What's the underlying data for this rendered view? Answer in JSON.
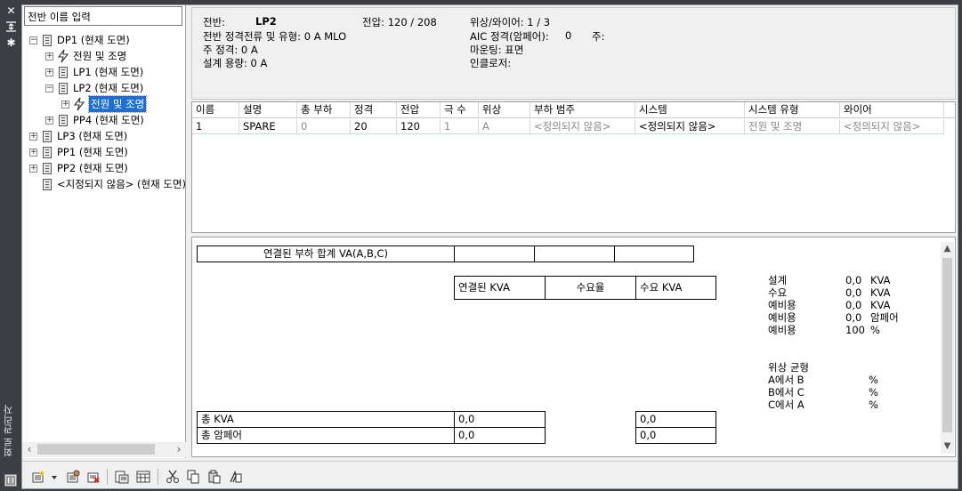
{
  "palette": {
    "title": "회로 관리자",
    "icons": [
      "close-icon",
      "auto-hide-icon",
      "settings-icon",
      "palette-app-icon"
    ]
  },
  "tree": {
    "search_text": "전반 이름 입력",
    "items": [
      {
        "label": "DP1 (현재 도면)",
        "type": "panel",
        "expander": "−"
      },
      {
        "label": "전원 및 조명",
        "type": "circuit",
        "expander": "+"
      },
      {
        "label": "LP1 (현재 도면)",
        "type": "panel",
        "expander": "+"
      },
      {
        "label": "LP2 (현재 도면)",
        "type": "panel",
        "expander": "−"
      },
      {
        "label": "전원 및 조명",
        "type": "circuit",
        "expander": "+",
        "selected": true
      },
      {
        "label": "PP4 (현재 도면)",
        "type": "panel",
        "expander": "+"
      },
      {
        "label": "LP3 (현재 도면)",
        "type": "panel",
        "expander": "+"
      },
      {
        "label": "PP1 (현재 도면)",
        "type": "panel",
        "expander": "+"
      },
      {
        "label": "PP2 (현재 도면)",
        "type": "panel",
        "expander": "+"
      },
      {
        "label": "<지정되지 않음> (현재 도면)",
        "type": "panel",
        "expander": ""
      }
    ]
  },
  "info": {
    "panel_label": "전반:",
    "panel_value": "LP2",
    "voltage": "전압: 120 / 208",
    "phase_wires": "위상/와이어: 1 /  3",
    "rating_type": "전반 정격전류 및 유형: 0 A MLO",
    "aic_label": "AIC 정격(암페어):",
    "aic_value": "0",
    "note_label": "주:",
    "main_rating": "주 정격: 0 A",
    "mounting": "마운팅: 표면",
    "design_capacity": "설계 용량: 0 A",
    "enclosure": "인클로저:"
  },
  "grid": {
    "columns": [
      "이름",
      "설명",
      "총 부하",
      "정격",
      "전압",
      "극 수",
      "위상",
      "부하 범주",
      "시스템",
      "시스템 유형",
      "와이어"
    ],
    "rows": [
      [
        "1",
        "SPARE",
        "0",
        "20",
        "120",
        "1",
        "A",
        "<정의되지 않음>",
        "<정의되지 않음>",
        "전원 및 조명",
        "<정의되지 않음>"
      ]
    ]
  },
  "summary": {
    "connected_load_total": "연결된 부하 합계 VA(A,B,C)",
    "headers": [
      "연결된 KVA",
      "수요율",
      "수요 KVA"
    ],
    "total_kva_label": "총 KVA",
    "total_amp_label": "총 암페어",
    "total_kva_value": "0,0",
    "total_kva_demand": "0,0",
    "total_amp_value": "0,0",
    "total_amp_demand": "0,0",
    "stats": [
      {
        "label": "설계",
        "value": "0,0",
        "unit": "KVA"
      },
      {
        "label": "수요",
        "value": "0,0",
        "unit": "KVA"
      },
      {
        "label": "예비용",
        "value": "0,0",
        "unit": "KVA"
      },
      {
        "label": "예비용",
        "value": "0,0",
        "unit": "암페어"
      },
      {
        "label": "예비용",
        "value": "100",
        "unit": "%"
      }
    ],
    "balance_title": "위상 균형",
    "balance": [
      {
        "label": "A에서 B",
        "unit": "%"
      },
      {
        "label": "B에서 C",
        "unit": "%"
      },
      {
        "label": "C에서 A",
        "unit": "%"
      }
    ]
  },
  "toolbar": {
    "icons": [
      "new-circuit-icon",
      "dropdown-arrow-icon",
      "circuit-properties-icon",
      "delete-circuit-icon",
      "circuit-report-icon",
      "panel-schedule-icon",
      "cut-icon",
      "copy-icon",
      "paste-icon",
      "electrical-project-icon"
    ]
  }
}
